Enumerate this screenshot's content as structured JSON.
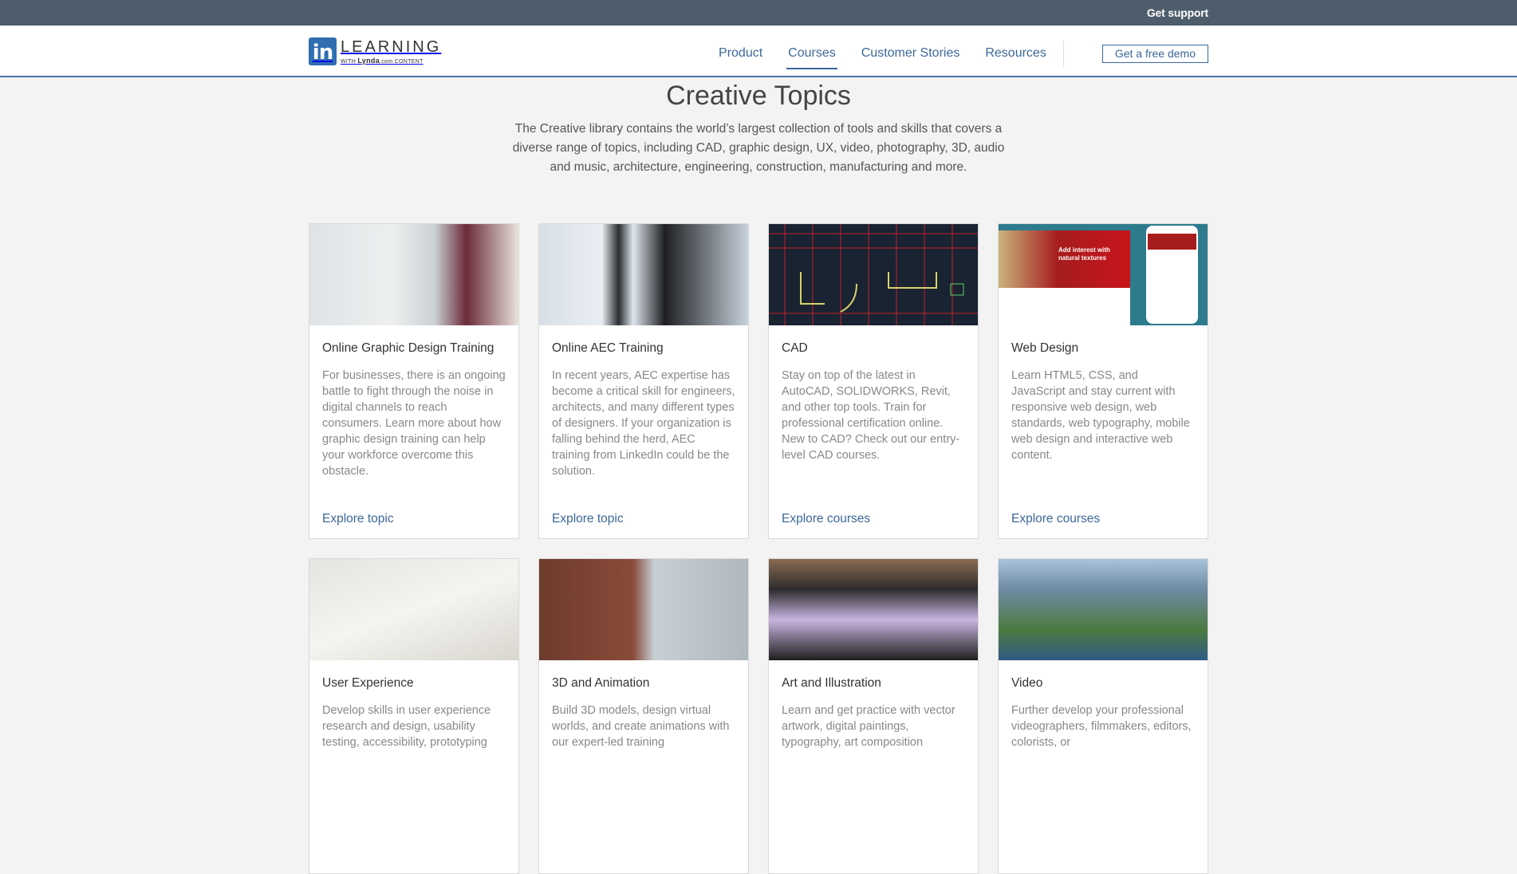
{
  "topbar": {
    "support_label": "Get support"
  },
  "header": {
    "logo": {
      "mark": "in",
      "word": "LEARNING",
      "sub_prefix": "WITH ",
      "sub_brand": "Lynda",
      "sub_suffix": ".com CONTENT"
    },
    "nav": [
      {
        "label": "Product",
        "active": false
      },
      {
        "label": "Courses",
        "active": true
      },
      {
        "label": "Customer Stories",
        "active": false
      },
      {
        "label": "Resources",
        "active": false
      }
    ],
    "demo_label": "Get a free demo"
  },
  "hero": {
    "title": "Creative Topics",
    "description": "The Creative library contains the world’s largest collection of tools and skills that covers a diverse range of topics, including CAD, graphic design, UX, video, photography, 3D, audio and music, architecture, engineering, construction, manufacturing and more."
  },
  "cards": [
    {
      "title": "Online Graphic Design Training",
      "description": "For businesses, there is an ongoing battle to fight through the noise in digital channels to reach consumers. Learn more about how graphic design training can help your workforce overcome this obstacle.",
      "link": "Explore topic",
      "image": "people-at-whiteboard-image"
    },
    {
      "title": "Online AEC Training",
      "description": "In recent years, AEC expertise has become a critical skill for engineers, architects, and many different types of designers. If your organization is falling behind the herd, AEC training from LinkedIn could be the solution.",
      "link": "Explore topic",
      "image": "engineers-reviewing-plans-image"
    },
    {
      "title": "CAD",
      "description": "Stay on top of the latest in AutoCAD, SOLIDWORKS, Revit, and other top tools. Train for professional certification online. New to CAD? Check out our entry-level CAD courses.",
      "link": "Explore courses",
      "image": "cad-floorplan-image"
    },
    {
      "title": "Web Design",
      "description": "Learn HTML5, CSS, and JavaScript and stay current with responsive web design, web standards, web typography, mobile web design and interactive web content.",
      "link": "Explore courses",
      "image": "responsive-website-image",
      "image_text": "Add interest with natural textures"
    },
    {
      "title": "User Experience",
      "description": "Develop skills in user experience research and design, usability testing, accessibility, prototyping",
      "link": "",
      "image": "ux-sticky-notes-image"
    },
    {
      "title": "3D and Animation",
      "description": "Build 3D models, design virtual worlds, and create animations with our expert-led training",
      "link": "",
      "image": "3d-room-render-image"
    },
    {
      "title": "Art and Illustration",
      "description": "Learn and get practice with vector artwork, digital paintings, typography, art composition",
      "link": "",
      "image": "drawing-tablet-image"
    },
    {
      "title": "Video",
      "description": "Further develop your professional videographers, filmmakers, editors, colorists, or",
      "link": "",
      "image": "videographer-camera-image"
    }
  ]
}
